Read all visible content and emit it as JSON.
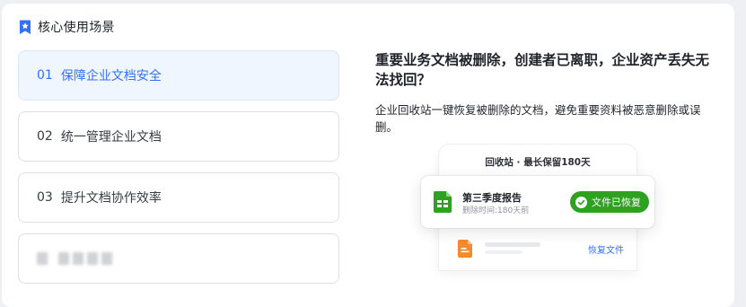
{
  "section": {
    "title": "核心使用场景",
    "icon": "bookmark-star-icon"
  },
  "tabs": [
    {
      "num": "01",
      "label": "保障企业文档安全",
      "active": true
    },
    {
      "num": "02",
      "label": "统一管理企业文档",
      "active": false
    },
    {
      "num": "03",
      "label": "提升文档协作效率",
      "active": false
    }
  ],
  "detail": {
    "headline": "重要业务文档被删除，创建者已离职，企业资产丢失无法找回？",
    "description": "企业回收站一键恢复被删除的文档，避免重要资料被恶意删除或误删。"
  },
  "mock": {
    "title": "回收站 · 最长保留180天",
    "file_name": "第三季度报告",
    "file_meta": "删除时间:180天前",
    "restored_badge": "文件已恢复",
    "restore_link": "恢复文件"
  },
  "colors": {
    "accent": "#3370ff",
    "active_bg": "#f0f6ff",
    "success": "#2ea121",
    "sheet_icon": "#2ea121",
    "doc_icon": "#f5892b"
  }
}
